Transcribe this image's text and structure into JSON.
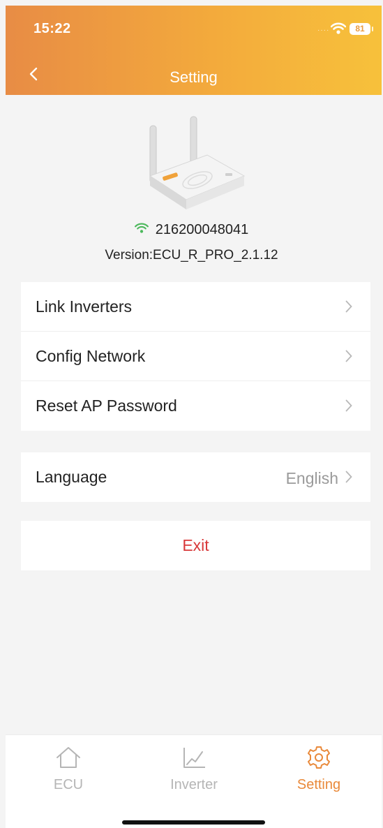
{
  "status": {
    "time": "15:22",
    "battery": "81"
  },
  "nav": {
    "title": "Setting"
  },
  "device": {
    "serial": "216200048041",
    "version": "Version:ECU_R_PRO_2.1.12"
  },
  "menu": [
    {
      "label": "Link Inverters"
    },
    {
      "label": "Config Network"
    },
    {
      "label": "Reset AP Password"
    }
  ],
  "language": {
    "label": "Language",
    "value": "English"
  },
  "exit": {
    "label": "Exit"
  },
  "tabs": [
    {
      "label": "ECU",
      "icon": "home-icon",
      "active": false
    },
    {
      "label": "Inverter",
      "icon": "chart-icon",
      "active": false
    },
    {
      "label": "Setting",
      "icon": "gear-icon",
      "active": true
    }
  ],
  "colors": {
    "accent": "#e9893a",
    "exit": "#d8393a",
    "wifi": "#4cb85c"
  }
}
